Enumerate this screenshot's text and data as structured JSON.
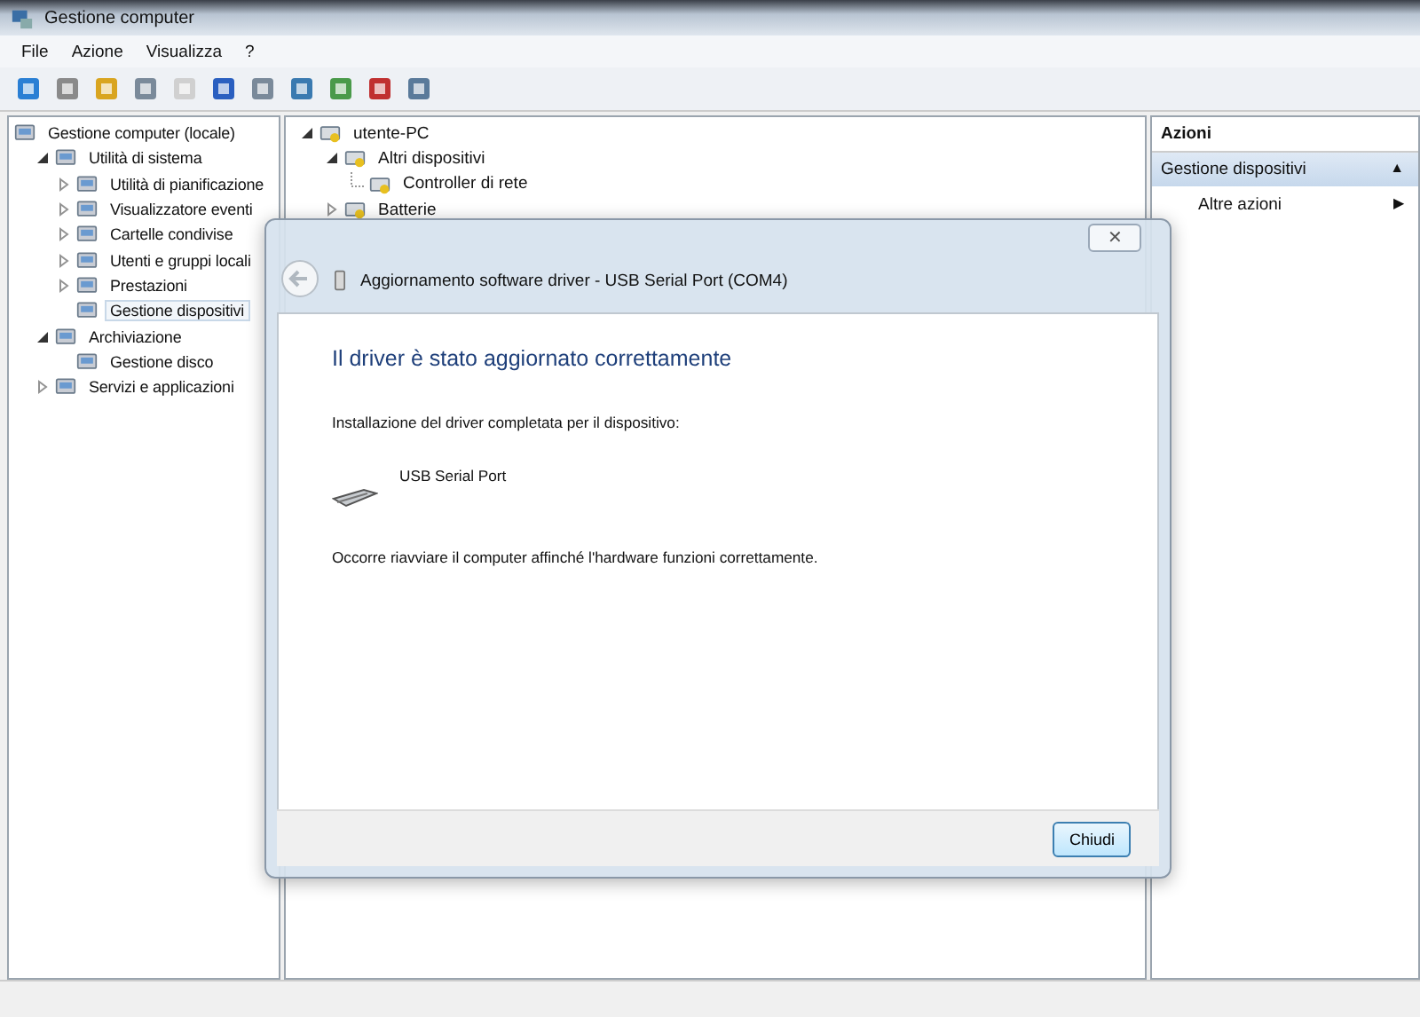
{
  "window": {
    "title": "Gestione computer"
  },
  "menu": [
    "File",
    "Azione",
    "Visualizza",
    "?"
  ],
  "toolbar": [
    {
      "disabled": false
    },
    {
      "disabled": false
    },
    {
      "disabled": false
    },
    {
      "disabled": false
    },
    {
      "disabled": true
    },
    {
      "disabled": false
    },
    {
      "disabled": false
    },
    {
      "disabled": false
    },
    {
      "disabled": false
    },
    {
      "disabled": false
    },
    {
      "disabled": false
    }
  ],
  "console_tree": [
    {
      "label": "Gestione computer (locale)",
      "kind": "root",
      "selected": false,
      "children": [
        {
          "label": "Utilità di sistema",
          "kind": "branch",
          "expanded": true,
          "selected": false,
          "children": [
            {
              "label": "Utilità di pianificazione",
              "kind": "branch",
              "expanded": false,
              "selected": false
            },
            {
              "label": "Visualizzatore eventi",
              "kind": "branch",
              "expanded": false,
              "selected": false
            },
            {
              "label": "Cartelle condivise",
              "kind": "branch",
              "expanded": false,
              "selected": false
            },
            {
              "label": "Utenti e gruppi locali",
              "kind": "branch",
              "expanded": false,
              "selected": false
            },
            {
              "label": "Prestazioni",
              "kind": "branch",
              "expanded": false,
              "selected": false
            },
            {
              "label": "Gestione dispositivi",
              "kind": "leaf",
              "selected": true
            }
          ]
        },
        {
          "label": "Archiviazione",
          "kind": "branch",
          "expanded": true,
          "selected": false,
          "children": [
            {
              "label": "Gestione disco",
              "kind": "leaf",
              "selected": false
            }
          ]
        },
        {
          "label": "Servizi e applicazioni",
          "kind": "branch",
          "expanded": false,
          "selected": false
        }
      ]
    }
  ],
  "device_tree": [
    {
      "label": "utente-PC",
      "kind": "branch",
      "expanded": true,
      "children": [
        {
          "label": "Altri dispositivi",
          "kind": "branch",
          "expanded": true,
          "children": [
            {
              "label": "Controller di rete",
              "kind": "leaf"
            }
          ]
        },
        {
          "label": "Batterie",
          "kind": "branch",
          "expanded": false
        }
      ]
    }
  ],
  "actions": {
    "header": "Azioni",
    "section": {
      "label": "Gestione dispositivi",
      "arrow": "▲"
    },
    "items": [
      {
        "label": "Altre azioni",
        "arrow": "▶"
      }
    ]
  },
  "dialog": {
    "close": "✕",
    "title": "Aggiornamento software driver - USB Serial Port (COM4)",
    "heading": "Il driver è stato aggiornato correttamente",
    "intro": "Installazione del driver completata per il dispositivo:",
    "device": "USB Serial Port",
    "note": "Occorre riavviare il computer affinché l'hardware funzioni correttamente.",
    "button": "Chiudi"
  }
}
